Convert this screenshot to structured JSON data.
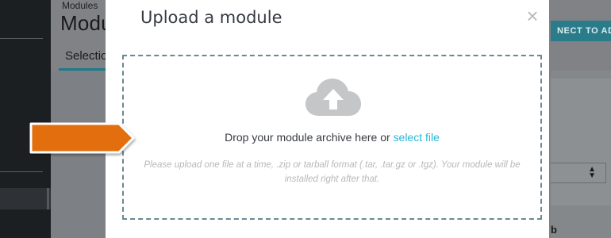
{
  "background": {
    "breadcrumb": "Modules",
    "page_title": "Modu",
    "tab_label": "Selectio",
    "connect_button": "NECT TO AD",
    "bottom_fragment": "b"
  },
  "modal": {
    "title": "Upload a module",
    "close_symbol": "×",
    "dropzone": {
      "text_prefix": "Drop your module archive here or ",
      "link_text": "select file",
      "hint": "Please upload one file at a time, .zip or tarball format (.tar, .tar.gz or .tgz). Your module will be installed right after that."
    }
  },
  "icons": {
    "upload": "cloud-upload-icon",
    "close": "close-icon",
    "annotation": "orange-arrow-icon",
    "select": "select-arrows-icon"
  },
  "colors": {
    "accent": "#25b9d7",
    "arrow": "#e26e0f",
    "teal_button": "#2a7c8a"
  }
}
